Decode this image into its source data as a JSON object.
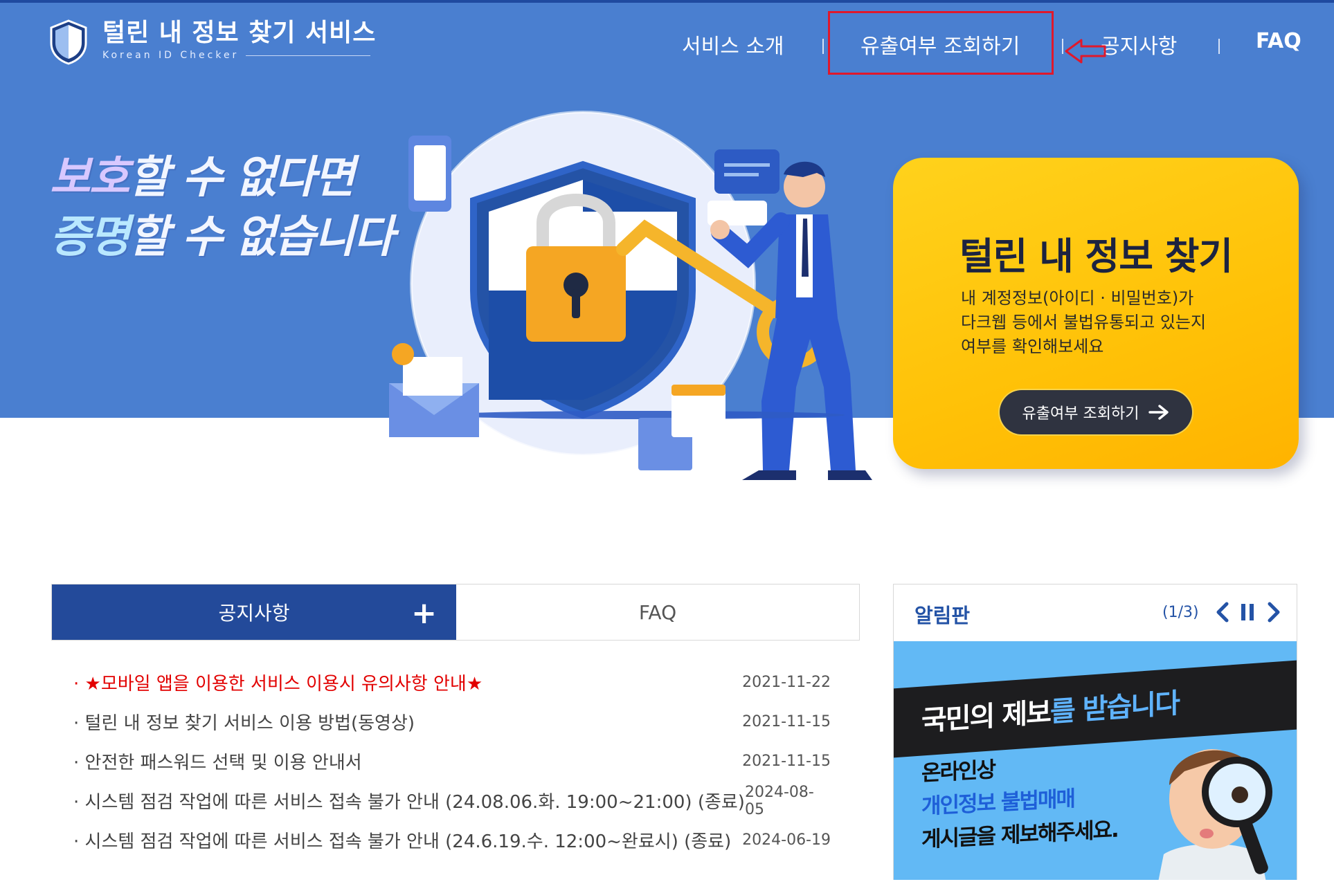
{
  "header": {
    "logo_title": "털린 내 정보 찾기 서비스",
    "logo_subtitle": "Korean ID Checker",
    "nav": [
      {
        "label": "서비스 소개"
      },
      {
        "label": "유출여부 조회하기"
      },
      {
        "label": "공지사항"
      },
      {
        "label": "FAQ"
      }
    ]
  },
  "hero": {
    "slogan_line1_accent": "보호",
    "slogan_line1_rest": "할 수 없다면",
    "slogan_line2_accent": "증명",
    "slogan_line2_rest": "할 수 없습니다",
    "card_title": "털린 내 정보 찾기",
    "card_desc": "내 계정정보(아이디 · 비밀번호)가\n다크웹 등에서 불법유통되고 있는지\n여부를 확인해보세요",
    "card_button": "유출여부 조회하기"
  },
  "notices": {
    "tab_notice": "공지사항",
    "tab_faq": "FAQ",
    "items": [
      {
        "title": "· ★모바일 앱을 이용한 서비스 이용시 유의사항 안내★",
        "date": "2021-11-22"
      },
      {
        "title": "· 털린 내 정보 찾기 서비스 이용 방법(동영상)",
        "date": "2021-11-15"
      },
      {
        "title": "· 안전한 패스워드 선택 및 이용 안내서",
        "date": "2021-11-15"
      },
      {
        "title": "· 시스템 점검 작업에 따른 서비스 접속 불가 안내 (24.08.06.화. 19:00~21:00) (종료)",
        "date": "2024-08-05"
      },
      {
        "title": "· 시스템 점검 작업에 따른 서비스 접속 불가 안내 (24.6.19.수. 12:00~완료시) (종료)",
        "date": "2024-06-19"
      }
    ]
  },
  "board": {
    "title": "알림판",
    "count": "(1/3)",
    "banner_headline_a": "국민의 제보",
    "banner_headline_b": "를 받습니다",
    "banner_line1": "온라인상",
    "banner_line2": "개인정보 불법매매",
    "banner_line3": "게시글을 제보해주세요."
  },
  "icons": [
    "shield-icon",
    "arrow-right-icon",
    "plus-icon",
    "chevron-left-icon",
    "pause-icon",
    "chevron-right-icon",
    "red-arrow-icon"
  ],
  "colors": {
    "hero_bg": "#4a7fd0",
    "card_bg": "#ffc107",
    "tab_active": "#234a9a",
    "highlight_border": "#e0182b",
    "hot_notice": "#e20000"
  }
}
